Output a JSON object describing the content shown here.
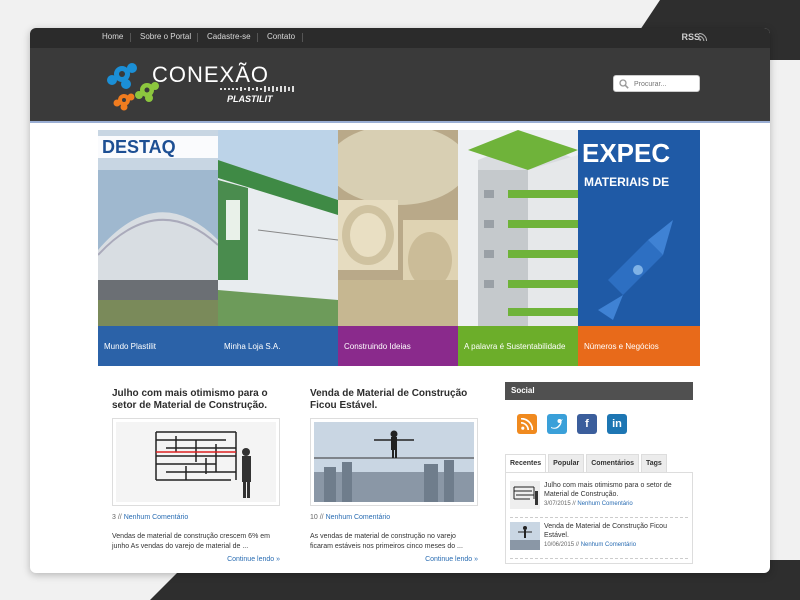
{
  "nav": {
    "items": [
      "Home",
      "Sobre o Portal",
      "Cadastre-se",
      "Contato"
    ],
    "rss_label": "RSS"
  },
  "logo": {
    "name": "CONEXÃO",
    "sub": "PLASTILIT"
  },
  "search": {
    "placeholder": "Procurar..."
  },
  "slider": {
    "panels": [
      {
        "caption": "Mundo Plastilit",
        "overlay": "DESTAQ",
        "color": "#2b62a8"
      },
      {
        "caption": "Minha Loja S.A.",
        "overlay": "",
        "color": "#2b62a8"
      },
      {
        "caption": "Construindo Ideias",
        "overlay": "",
        "color": "#8a2a8c"
      },
      {
        "caption": "A palavra é Sustentabilidade",
        "overlay": "",
        "color": "#6cae2a"
      },
      {
        "caption": "Números e Negócios",
        "overlay": "EXPEC",
        "overlay2": "MATERIAIS DE",
        "color": "#e86a1a"
      }
    ]
  },
  "posts": [
    {
      "title": "Julho com mais otimismo para o setor de Material de Construção.",
      "count": "3",
      "comments": "Nenhum Comentário",
      "excerpt": "Vendas de material de construção crescem 6% em junho As vendas do varejo de material de ...",
      "more": "Continue lendo »"
    },
    {
      "title": "Venda de Material de Construção Ficou Estável.",
      "count": "10",
      "comments": "Nenhum Comentário",
      "excerpt": "As vendas de material de construção no varejo ficaram estáveis nos primeiros cinco meses do ...",
      "more": "Continue lendo »"
    }
  ],
  "sidebar": {
    "social_title": "Social",
    "tabs": [
      "Recentes",
      "Popular",
      "Comentários",
      "Tags"
    ],
    "recent": [
      {
        "title": "Julho com mais otimismo para o setor de Material de Construção.",
        "date": "3/07/2015",
        "comments": "Nenhum Comentário"
      },
      {
        "title": "Venda de Material de Construção Ficou Estável.",
        "date": "10/06/2015",
        "comments": "Nenhum Comentário"
      }
    ]
  }
}
